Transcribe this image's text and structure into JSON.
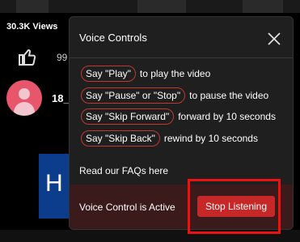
{
  "page": {
    "views": "30.3K Views",
    "like_count": "99",
    "channel_name": "18_",
    "thumbnail_text": "H"
  },
  "popup": {
    "title": "Voice Controls",
    "commands": [
      {
        "command": "Say \"Play\"",
        "description": "to play the video"
      },
      {
        "command": "Say \"Pause\" or \"Stop\"",
        "description": "to pause the video"
      },
      {
        "command": "Say \"Skip Forward\"",
        "description": "forward by 10 seconds"
      },
      {
        "command": "Say \"Skip Back\"",
        "description": "rewind by 10 seconds"
      }
    ],
    "faq_link": "Read our FAQs here",
    "status_text": "Voice Control is Active",
    "stop_button": "Stop Listening"
  },
  "colors": {
    "accent": "#c62828",
    "footer_bg": "#3a1a1a",
    "popup_bg": "#1f1f1f"
  }
}
